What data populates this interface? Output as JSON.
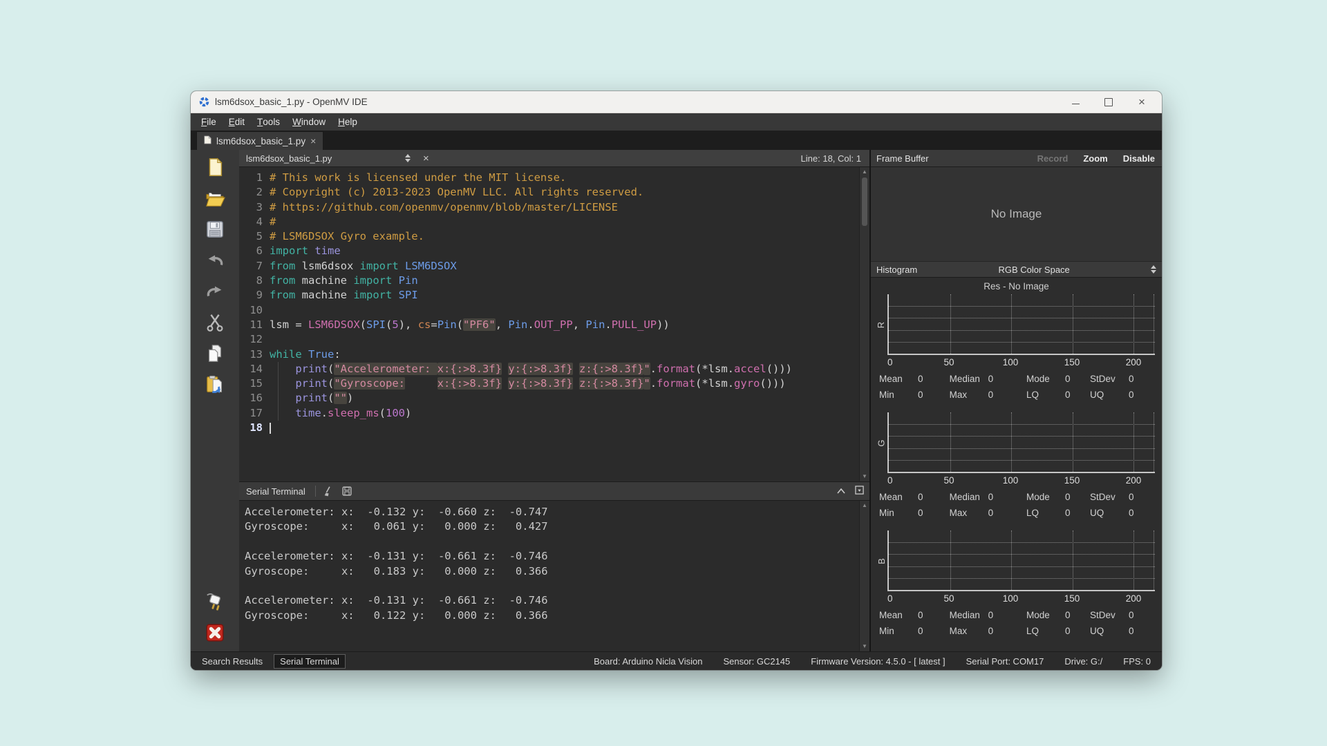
{
  "window": {
    "title": "lsm6dsox_basic_1.py - OpenMV IDE"
  },
  "menu": {
    "items": [
      "File",
      "Edit",
      "Tools",
      "Window",
      "Help"
    ]
  },
  "tab": {
    "label": "lsm6dsox_basic_1.py"
  },
  "toolbar": {
    "top_icons": [
      "new-file",
      "open-file",
      "save-file",
      "undo",
      "redo",
      "cut",
      "copy",
      "paste"
    ],
    "bottom_icons": [
      "connect",
      "disconnect"
    ]
  },
  "editor": {
    "filename": "lsm6dsox_basic_1.py",
    "cursor_position": "Line: 18, Col: 1",
    "lines": [
      {
        "n": 1,
        "seg": [
          [
            "cm",
            "# This work is licensed under the MIT license."
          ]
        ]
      },
      {
        "n": 2,
        "seg": [
          [
            "cm",
            "# Copyright (c) 2013-2023 OpenMV LLC. All rights reserved."
          ]
        ]
      },
      {
        "n": 3,
        "seg": [
          [
            "cm",
            "# https://github.com/openmv/openmv/blob/master/LICENSE"
          ]
        ]
      },
      {
        "n": 4,
        "seg": [
          [
            "cm",
            "#"
          ]
        ]
      },
      {
        "n": 5,
        "seg": [
          [
            "cm",
            "# LSM6DSOX Gyro example."
          ]
        ]
      },
      {
        "n": 6,
        "seg": [
          [
            "kw",
            "import"
          ],
          [
            "pl",
            " "
          ],
          [
            "pu",
            "time"
          ]
        ]
      },
      {
        "n": 7,
        "seg": [
          [
            "kw",
            "from"
          ],
          [
            "pl",
            " lsm6dsox "
          ],
          [
            "kw",
            "import"
          ],
          [
            "pl",
            " "
          ],
          [
            "bl",
            "LSM6DSOX"
          ]
        ]
      },
      {
        "n": 8,
        "seg": [
          [
            "kw",
            "from"
          ],
          [
            "pl",
            " machine "
          ],
          [
            "kw",
            "import"
          ],
          [
            "pl",
            " "
          ],
          [
            "bl",
            "Pin"
          ]
        ]
      },
      {
        "n": 9,
        "seg": [
          [
            "kw",
            "from"
          ],
          [
            "pl",
            " machine "
          ],
          [
            "kw",
            "import"
          ],
          [
            "pl",
            " "
          ],
          [
            "bl",
            "SPI"
          ]
        ]
      },
      {
        "n": 10,
        "seg": []
      },
      {
        "n": 11,
        "seg": [
          [
            "pl",
            "lsm = "
          ],
          [
            "mg",
            "LSM6DSOX"
          ],
          [
            "pl",
            "("
          ],
          [
            "bl",
            "SPI"
          ],
          [
            "pl",
            "("
          ],
          [
            "num",
            "5"
          ],
          [
            "pl",
            "), "
          ],
          [
            "par",
            "cs"
          ],
          [
            "pl",
            "="
          ],
          [
            "bl",
            "Pin"
          ],
          [
            "pl",
            "("
          ],
          [
            "s",
            "\"PF6\""
          ],
          [
            "pl",
            ", "
          ],
          [
            "bl",
            "Pin"
          ],
          [
            "pl",
            "."
          ],
          [
            "mg",
            "OUT_PP"
          ],
          [
            "pl",
            ", "
          ],
          [
            "bl",
            "Pin"
          ],
          [
            "pl",
            "."
          ],
          [
            "mg",
            "PULL_UP"
          ],
          [
            "pl",
            "))"
          ]
        ]
      },
      {
        "n": 12,
        "seg": []
      },
      {
        "n": 13,
        "seg": [
          [
            "kw",
            "while"
          ],
          [
            "pl",
            " "
          ],
          [
            "bl",
            "True"
          ],
          [
            "pl",
            ":"
          ]
        ]
      },
      {
        "n": 14,
        "guide": true,
        "seg": [
          [
            "pl",
            "    "
          ],
          [
            "pu",
            "print"
          ],
          [
            "pl",
            "("
          ],
          [
            "s",
            "\"Accelerometer: "
          ],
          [
            "s",
            "x:{:>8.3f}"
          ],
          [
            "pl",
            " "
          ],
          [
            "s",
            "y:{:>8.3f}"
          ],
          [
            "pl",
            " "
          ],
          [
            "s",
            "z:{:>8.3f}"
          ],
          [
            "s",
            "\""
          ],
          [
            "pl",
            "."
          ],
          [
            "mg",
            "format"
          ],
          [
            "pl",
            "(*lsm."
          ],
          [
            "mg",
            "accel"
          ],
          [
            "pl",
            "()))"
          ]
        ]
      },
      {
        "n": 15,
        "guide": true,
        "seg": [
          [
            "pl",
            "    "
          ],
          [
            "pu",
            "print"
          ],
          [
            "pl",
            "("
          ],
          [
            "s",
            "\"Gyroscope:"
          ],
          [
            "pl",
            "     "
          ],
          [
            "s",
            "x:{:>8.3f}"
          ],
          [
            "pl",
            " "
          ],
          [
            "s",
            "y:{:>8.3f}"
          ],
          [
            "pl",
            " "
          ],
          [
            "s",
            "z:{:>8.3f}"
          ],
          [
            "s",
            "\""
          ],
          [
            "pl",
            "."
          ],
          [
            "mg",
            "format"
          ],
          [
            "pl",
            "(*lsm."
          ],
          [
            "mg",
            "gyro"
          ],
          [
            "pl",
            "()))"
          ]
        ]
      },
      {
        "n": 16,
        "guide": true,
        "seg": [
          [
            "pl",
            "    "
          ],
          [
            "pu",
            "print"
          ],
          [
            "pl",
            "("
          ],
          [
            "s",
            "\"\""
          ],
          [
            "pl",
            ")"
          ]
        ]
      },
      {
        "n": 17,
        "guide": true,
        "seg": [
          [
            "pl",
            "    "
          ],
          [
            "pu",
            "time"
          ],
          [
            "pl",
            "."
          ],
          [
            "mg",
            "sleep_ms"
          ],
          [
            "pl",
            "("
          ],
          [
            "num",
            "100"
          ],
          [
            "pl",
            ")"
          ]
        ]
      },
      {
        "n": 18,
        "cursor": true,
        "seg": []
      }
    ]
  },
  "serial_terminal": {
    "title": "Serial Terminal",
    "lines": [
      "Accelerometer: x:  -0.132 y:  -0.660 z:  -0.747",
      "Gyroscope:     x:   0.061 y:   0.000 z:   0.427",
      "",
      "Accelerometer: x:  -0.131 y:  -0.661 z:  -0.746",
      "Gyroscope:     x:   0.183 y:   0.000 z:   0.366",
      "",
      "Accelerometer: x:  -0.131 y:  -0.661 z:  -0.746",
      "Gyroscope:     x:   0.122 y:   0.000 z:   0.366"
    ]
  },
  "frame_buffer": {
    "title": "Frame Buffer",
    "record_label": "Record",
    "zoom_label": "Zoom",
    "disable_label": "Disable",
    "placeholder": "No Image"
  },
  "histogram": {
    "title": "Histogram",
    "color_space": "RGB Color Space",
    "resolution": "Res - No Image",
    "x_ticks": [
      "0",
      "50",
      "100",
      "150",
      "200"
    ],
    "channels": [
      {
        "label": "R",
        "stats_row1": [
          [
            "Mean",
            "0"
          ],
          [
            "Median",
            "0"
          ],
          [
            "Mode",
            "0"
          ],
          [
            "StDev",
            "0"
          ]
        ],
        "stats_row2": [
          [
            "Min",
            "0"
          ],
          [
            "Max",
            "0"
          ],
          [
            "LQ",
            "0"
          ],
          [
            "UQ",
            "0"
          ]
        ]
      },
      {
        "label": "G",
        "stats_row1": [
          [
            "Mean",
            "0"
          ],
          [
            "Median",
            "0"
          ],
          [
            "Mode",
            "0"
          ],
          [
            "StDev",
            "0"
          ]
        ],
        "stats_row2": [
          [
            "Min",
            "0"
          ],
          [
            "Max",
            "0"
          ],
          [
            "LQ",
            "0"
          ],
          [
            "UQ",
            "0"
          ]
        ]
      },
      {
        "label": "B",
        "stats_row1": [
          [
            "Mean",
            "0"
          ],
          [
            "Median",
            "0"
          ],
          [
            "Mode",
            "0"
          ],
          [
            "StDev",
            "0"
          ]
        ],
        "stats_row2": [
          [
            "Min",
            "0"
          ],
          [
            "Max",
            "0"
          ],
          [
            "LQ",
            "0"
          ],
          [
            "UQ",
            "0"
          ]
        ]
      }
    ]
  },
  "status_bar": {
    "tabs": [
      {
        "label": "Search Results",
        "active": false
      },
      {
        "label": "Serial Terminal",
        "active": true
      }
    ],
    "fields": [
      "Board: Arduino Nicla Vision",
      "Sensor: GC2145",
      "Firmware Version: 4.5.0 - [ latest ]",
      "Serial Port: COM17",
      "Drive: G:/",
      "FPS: 0"
    ]
  },
  "colors": {
    "desktop_bg": "#d8eeec",
    "editor_bg": "#2b2b2b",
    "panel_bg": "#3a3a3a",
    "comment": "#cf9c43",
    "keyword": "#42b3a4",
    "type_blue": "#6d9ce8",
    "builtin_purple": "#9b94de",
    "method_pink": "#cf6fae",
    "number": "#bb77cc",
    "string": "#d389a0",
    "string_highlight_bg": "#47443e",
    "stop_button_red": "#c0281e"
  }
}
